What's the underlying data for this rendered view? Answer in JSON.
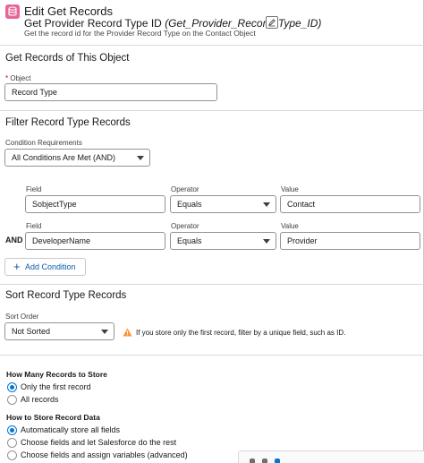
{
  "header": {
    "title": "Edit Get Records",
    "element_label": "Get Provider Record Type ID",
    "api_name": "(Get_Provider_Record_Type_ID)",
    "description": "Get the record id for the Provider Record Type on the Contact Object"
  },
  "get_records": {
    "title": "Get Records of This Object",
    "object_label": "Object",
    "required_marker": "*",
    "object_value": "Record Type"
  },
  "filter": {
    "title": "Filter Record Type Records",
    "condition_label": "Condition Requirements",
    "condition_value": "All Conditions Are Met (AND)",
    "rows": [
      {
        "field_label": "Field",
        "field": "SobjectType",
        "operator_label": "Operator",
        "operator": "Equals",
        "value_label": "Value",
        "value": "Contact"
      },
      {
        "connector": "AND",
        "field_label": "Field",
        "field": "DeveloperName",
        "operator_label": "Operator",
        "operator": "Equals",
        "value_label": "Value",
        "value": "Provider"
      }
    ],
    "add_condition_label": "Add Condition"
  },
  "sort": {
    "title": "Sort Record Type Records",
    "sort_order_label": "Sort Order",
    "sort_order_value": "Not Sorted",
    "warning": "If you store only the first record, filter by a unique field, such as ID."
  },
  "store": {
    "how_many_label": "How Many Records to Store",
    "how_many_options": [
      {
        "label": "Only the first record",
        "checked": true
      },
      {
        "label": "All records",
        "checked": false
      }
    ],
    "how_to_label": "How to Store Record Data",
    "how_to_options": [
      {
        "label": "Automatically store all fields",
        "checked": true
      },
      {
        "label": "Choose fields and let Salesforce do the rest",
        "checked": false
      },
      {
        "label": "Choose fields and assign variables (advanced)",
        "checked": false
      }
    ]
  },
  "colors": {
    "icon_pink": "#e86599",
    "brand_blue": "#0176d3",
    "warning": "#fe9339"
  }
}
